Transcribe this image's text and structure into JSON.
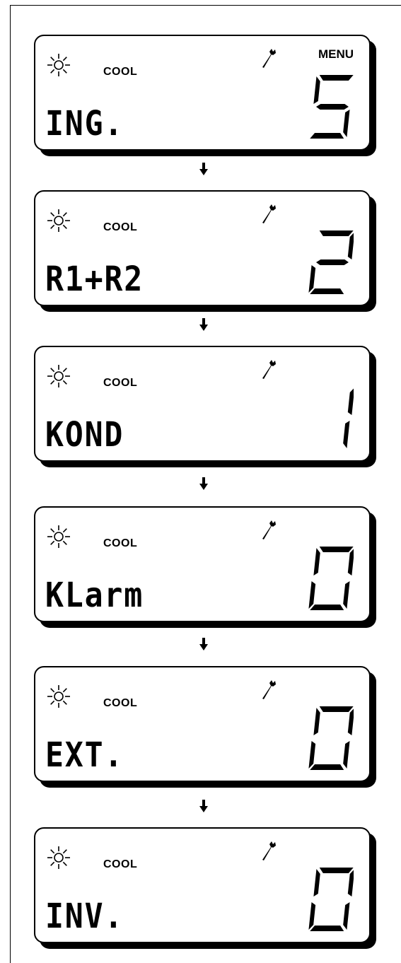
{
  "panels": [
    {
      "mode": "COOL",
      "menu": "MENU",
      "code": "ING.",
      "digit": "5"
    },
    {
      "mode": "COOL",
      "menu": "",
      "code": "R1+R2",
      "digit": "2"
    },
    {
      "mode": "COOL",
      "menu": "",
      "code": "KOND",
      "digit": "1"
    },
    {
      "mode": "COOL",
      "menu": "",
      "code": "KLarm",
      "digit": "0"
    },
    {
      "mode": "COOL",
      "menu": "",
      "code": "EXT.",
      "digit": "0"
    },
    {
      "mode": "COOL",
      "menu": "",
      "code": "INV.",
      "digit": "0"
    }
  ],
  "icons": {
    "sun": "sun-icon",
    "wrench": "wrench-icon",
    "arrow": "arrow-down-icon"
  }
}
